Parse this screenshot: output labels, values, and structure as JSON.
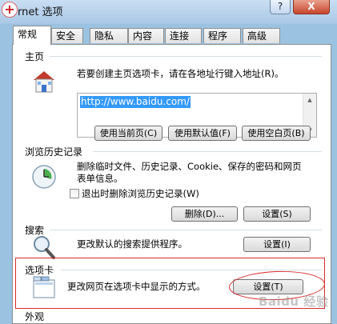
{
  "window": {
    "title": "rnet 选项",
    "help_label": "?",
    "close_label": "X"
  },
  "tabs": [
    {
      "label": "常规"
    },
    {
      "label": "安全"
    },
    {
      "label": "隐私"
    },
    {
      "label": "内容"
    },
    {
      "label": "连接"
    },
    {
      "label": "程序"
    },
    {
      "label": "高级"
    }
  ],
  "home": {
    "title": "主页",
    "description": "若要创建主页选项卡，请在各地址行键入地址(R)。",
    "url": "http://www.baidu.com/",
    "use_current": "使用当前页(C)",
    "use_default": "使用默认值(F)",
    "use_blank": "使用空白页(B)",
    "icon": "house-icon"
  },
  "history": {
    "title": "浏览历史记录",
    "description_line1": "删除临时文件、历史记录、Cookie、保存的密码和网页",
    "description_line2": "表单信息。",
    "checkbox_label": "退出时删除浏览历史记录(W)",
    "delete_button": "删除(D)...",
    "settings_button": "设置(S)",
    "icon": "history-clock-icon"
  },
  "search": {
    "title": "搜索",
    "description": "更改默认的搜索提供程序。",
    "settings_button": "设置(I)",
    "icon": "magnifier-icon"
  },
  "tabs_section": {
    "title": "选项卡",
    "description": "更改网页在选项卡中显示的方式。",
    "settings_button": "设置(T)",
    "icon": "tabbed-window-icon"
  },
  "appearance": {
    "title": "外观"
  },
  "watermark": "Baidu 经验",
  "colors": {
    "highlight": "#d72b2b",
    "selection": "#3399ff",
    "window_frame": "#9bc2e0"
  }
}
